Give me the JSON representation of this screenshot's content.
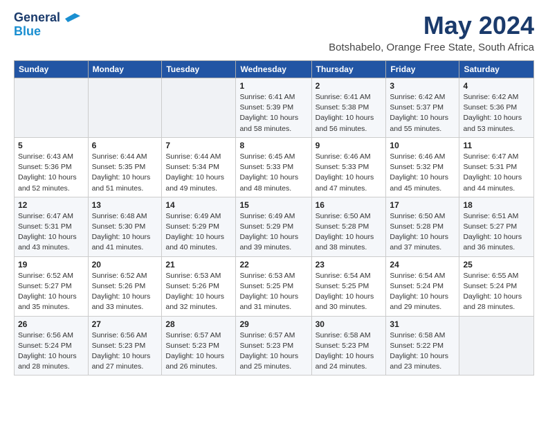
{
  "logo": {
    "line1": "General",
    "line2": "Blue"
  },
  "title": "May 2024",
  "subtitle": "Botshabelo, Orange Free State, South Africa",
  "days_of_week": [
    "Sunday",
    "Monday",
    "Tuesday",
    "Wednesday",
    "Thursday",
    "Friday",
    "Saturday"
  ],
  "weeks": [
    [
      {
        "day": "",
        "info": ""
      },
      {
        "day": "",
        "info": ""
      },
      {
        "day": "",
        "info": ""
      },
      {
        "day": "1",
        "info": "Sunrise: 6:41 AM\nSunset: 5:39 PM\nDaylight: 10 hours and 58 minutes."
      },
      {
        "day": "2",
        "info": "Sunrise: 6:41 AM\nSunset: 5:38 PM\nDaylight: 10 hours and 56 minutes."
      },
      {
        "day": "3",
        "info": "Sunrise: 6:42 AM\nSunset: 5:37 PM\nDaylight: 10 hours and 55 minutes."
      },
      {
        "day": "4",
        "info": "Sunrise: 6:42 AM\nSunset: 5:36 PM\nDaylight: 10 hours and 53 minutes."
      }
    ],
    [
      {
        "day": "5",
        "info": "Sunrise: 6:43 AM\nSunset: 5:36 PM\nDaylight: 10 hours and 52 minutes."
      },
      {
        "day": "6",
        "info": "Sunrise: 6:44 AM\nSunset: 5:35 PM\nDaylight: 10 hours and 51 minutes."
      },
      {
        "day": "7",
        "info": "Sunrise: 6:44 AM\nSunset: 5:34 PM\nDaylight: 10 hours and 49 minutes."
      },
      {
        "day": "8",
        "info": "Sunrise: 6:45 AM\nSunset: 5:33 PM\nDaylight: 10 hours and 48 minutes."
      },
      {
        "day": "9",
        "info": "Sunrise: 6:46 AM\nSunset: 5:33 PM\nDaylight: 10 hours and 47 minutes."
      },
      {
        "day": "10",
        "info": "Sunrise: 6:46 AM\nSunset: 5:32 PM\nDaylight: 10 hours and 45 minutes."
      },
      {
        "day": "11",
        "info": "Sunrise: 6:47 AM\nSunset: 5:31 PM\nDaylight: 10 hours and 44 minutes."
      }
    ],
    [
      {
        "day": "12",
        "info": "Sunrise: 6:47 AM\nSunset: 5:31 PM\nDaylight: 10 hours and 43 minutes."
      },
      {
        "day": "13",
        "info": "Sunrise: 6:48 AM\nSunset: 5:30 PM\nDaylight: 10 hours and 41 minutes."
      },
      {
        "day": "14",
        "info": "Sunrise: 6:49 AM\nSunset: 5:29 PM\nDaylight: 10 hours and 40 minutes."
      },
      {
        "day": "15",
        "info": "Sunrise: 6:49 AM\nSunset: 5:29 PM\nDaylight: 10 hours and 39 minutes."
      },
      {
        "day": "16",
        "info": "Sunrise: 6:50 AM\nSunset: 5:28 PM\nDaylight: 10 hours and 38 minutes."
      },
      {
        "day": "17",
        "info": "Sunrise: 6:50 AM\nSunset: 5:28 PM\nDaylight: 10 hours and 37 minutes."
      },
      {
        "day": "18",
        "info": "Sunrise: 6:51 AM\nSunset: 5:27 PM\nDaylight: 10 hours and 36 minutes."
      }
    ],
    [
      {
        "day": "19",
        "info": "Sunrise: 6:52 AM\nSunset: 5:27 PM\nDaylight: 10 hours and 35 minutes."
      },
      {
        "day": "20",
        "info": "Sunrise: 6:52 AM\nSunset: 5:26 PM\nDaylight: 10 hours and 33 minutes."
      },
      {
        "day": "21",
        "info": "Sunrise: 6:53 AM\nSunset: 5:26 PM\nDaylight: 10 hours and 32 minutes."
      },
      {
        "day": "22",
        "info": "Sunrise: 6:53 AM\nSunset: 5:25 PM\nDaylight: 10 hours and 31 minutes."
      },
      {
        "day": "23",
        "info": "Sunrise: 6:54 AM\nSunset: 5:25 PM\nDaylight: 10 hours and 30 minutes."
      },
      {
        "day": "24",
        "info": "Sunrise: 6:54 AM\nSunset: 5:24 PM\nDaylight: 10 hours and 29 minutes."
      },
      {
        "day": "25",
        "info": "Sunrise: 6:55 AM\nSunset: 5:24 PM\nDaylight: 10 hours and 28 minutes."
      }
    ],
    [
      {
        "day": "26",
        "info": "Sunrise: 6:56 AM\nSunset: 5:24 PM\nDaylight: 10 hours and 28 minutes."
      },
      {
        "day": "27",
        "info": "Sunrise: 6:56 AM\nSunset: 5:23 PM\nDaylight: 10 hours and 27 minutes."
      },
      {
        "day": "28",
        "info": "Sunrise: 6:57 AM\nSunset: 5:23 PM\nDaylight: 10 hours and 26 minutes."
      },
      {
        "day": "29",
        "info": "Sunrise: 6:57 AM\nSunset: 5:23 PM\nDaylight: 10 hours and 25 minutes."
      },
      {
        "day": "30",
        "info": "Sunrise: 6:58 AM\nSunset: 5:23 PM\nDaylight: 10 hours and 24 minutes."
      },
      {
        "day": "31",
        "info": "Sunrise: 6:58 AM\nSunset: 5:22 PM\nDaylight: 10 hours and 23 minutes."
      },
      {
        "day": "",
        "info": ""
      }
    ]
  ]
}
